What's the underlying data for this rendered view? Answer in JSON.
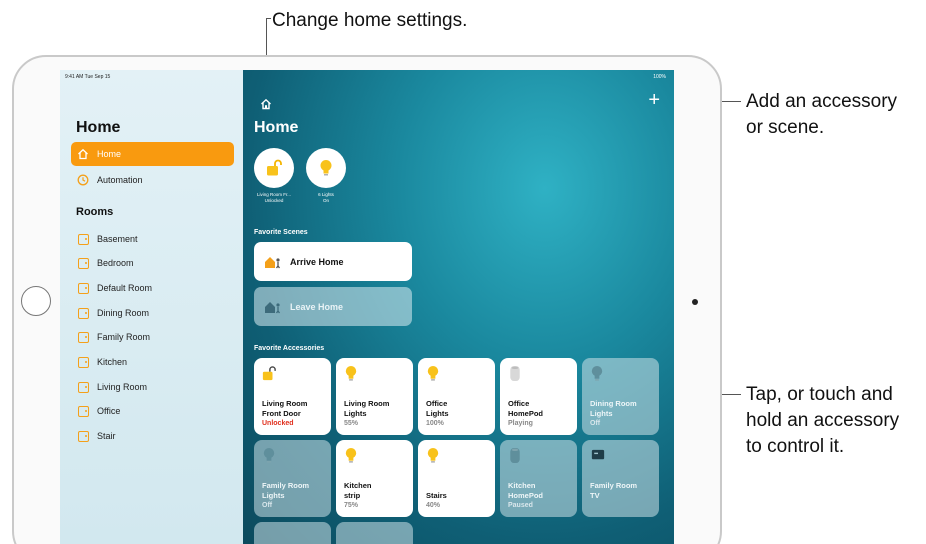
{
  "annotations": {
    "top": "Change home settings.",
    "right_top_line1": "Add an accessory",
    "right_top_line2": "or scene.",
    "right_mid_line1": "Tap, or touch and",
    "right_mid_line2": "hold an accessory",
    "right_mid_line3": "to control it."
  },
  "status_bar": {
    "time_date": "9:41 AM  Tue Sep 15",
    "battery": "100%"
  },
  "sidebar": {
    "title": "Home",
    "items": [
      {
        "label": "Home",
        "icon": "house-icon",
        "active": true
      },
      {
        "label": "Automation",
        "icon": "clock-icon",
        "active": false
      }
    ],
    "rooms_header": "Rooms",
    "rooms": [
      "Basement",
      "Bedroom",
      "Default Room",
      "Dining Room",
      "Family Room",
      "Kitchen",
      "Living Room",
      "Office",
      "Stair"
    ]
  },
  "main": {
    "title": "Home",
    "add_button": "+",
    "status": [
      {
        "label_line1": "Living Room Fr...",
        "label_line2": "Unlocked",
        "icon": "unlocked-lock-icon"
      },
      {
        "label_line1": "6 Lights",
        "label_line2": "On",
        "icon": "lightbulb-icon"
      }
    ],
    "favorite_scenes_label": "Favorite Scenes",
    "scenes": [
      {
        "label": "Arrive Home",
        "on": true
      },
      {
        "label": "Leave Home",
        "on": false
      }
    ],
    "favorite_accessories_label": "Favorite Accessories",
    "accessories": [
      {
        "name_line1": "Living Room",
        "name_line2": "Front Door",
        "state": "Unlocked",
        "on": true,
        "icon": "unlocked-lock-icon"
      },
      {
        "name_line1": "Living Room",
        "name_line2": "Lights",
        "state": "55%",
        "on": true,
        "icon": "lightbulb-icon"
      },
      {
        "name_line1": "Office",
        "name_line2": "Lights",
        "state": "100%",
        "on": true,
        "icon": "lightbulb-icon"
      },
      {
        "name_line1": "Office",
        "name_line2": "HomePod",
        "state": "Playing",
        "on": true,
        "icon": "homepod-icon"
      },
      {
        "name_line1": "Dining Room",
        "name_line2": "Lights",
        "state": "Off",
        "on": false,
        "icon": "lightbulb-icon"
      },
      {
        "name_line1": "Family Room",
        "name_line2": "Lights",
        "state": "Off",
        "on": false,
        "icon": "lightbulb-icon"
      },
      {
        "name_line1": "Kitchen",
        "name_line2": "strip",
        "state": "75%",
        "on": true,
        "icon": "lightbulb-icon"
      },
      {
        "name_line1": "Stairs",
        "name_line2": "",
        "state": "40%",
        "on": true,
        "icon": "lightbulb-icon"
      },
      {
        "name_line1": "Kitchen",
        "name_line2": "HomePod",
        "state": "Paused",
        "on": false,
        "icon": "homepod-icon"
      },
      {
        "name_line1": "Family Room",
        "name_line2": "TV",
        "state": "",
        "on": false,
        "icon": "tv-icon"
      }
    ]
  }
}
